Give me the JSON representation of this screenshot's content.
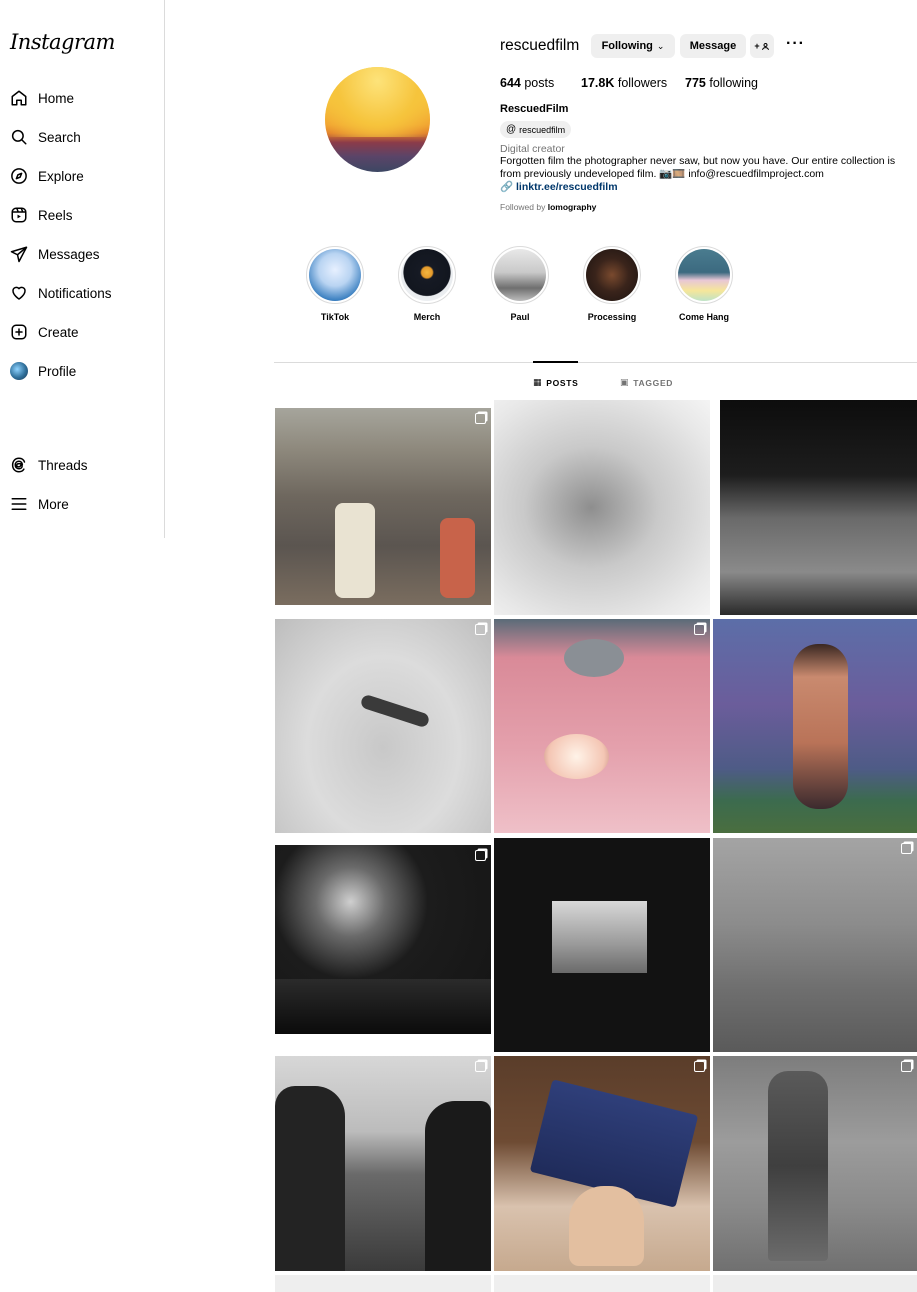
{
  "app": {
    "logo": "Instagram"
  },
  "sidebar": {
    "items": [
      {
        "label": "Home",
        "icon": "home-icon"
      },
      {
        "label": "Search",
        "icon": "search-icon"
      },
      {
        "label": "Explore",
        "icon": "compass-icon"
      },
      {
        "label": "Reels",
        "icon": "reels-icon"
      },
      {
        "label": "Messages",
        "icon": "paper-plane-icon"
      },
      {
        "label": "Notifications",
        "icon": "heart-icon"
      },
      {
        "label": "Create",
        "icon": "plus-square-icon"
      },
      {
        "label": "Profile",
        "icon": "avatar"
      }
    ],
    "bottom_items": [
      {
        "label": "Threads",
        "icon": "threads-icon"
      },
      {
        "label": "More",
        "icon": "menu-icon"
      }
    ]
  },
  "profile": {
    "username": "rescuedfilm",
    "following_button": "Following",
    "message_button": "Message",
    "add_user_button": "+",
    "more": "···",
    "posts_count": "644",
    "posts_label": "posts",
    "followers_count": "17.8K",
    "followers_label": "followers",
    "following_count": "775",
    "following_label": "following",
    "display_name": "RescuedFilm",
    "threads_handle": "rescuedfilm",
    "category": "Digital creator",
    "bio": "Forgotten film the photographer never saw, but now you have. Our entire collection is from previously undeveloped film. 📷🎞️ info@rescuedfilmproject.com",
    "link": "linktr.ee/rescuedfilm",
    "followed_by_prefix": "Followed by",
    "followed_by_user": "lomography"
  },
  "highlights": [
    {
      "label": "TikTok"
    },
    {
      "label": "Merch"
    },
    {
      "label": "Paul"
    },
    {
      "label": "Processing"
    },
    {
      "label": "Come Hang"
    }
  ],
  "tabs": {
    "posts": "POSTS",
    "tagged": "TAGGED"
  },
  "colors": {
    "link": "#00376b",
    "secondary_text": "#737373",
    "border": "#dbdbdb",
    "button_bg": "#efefef"
  }
}
